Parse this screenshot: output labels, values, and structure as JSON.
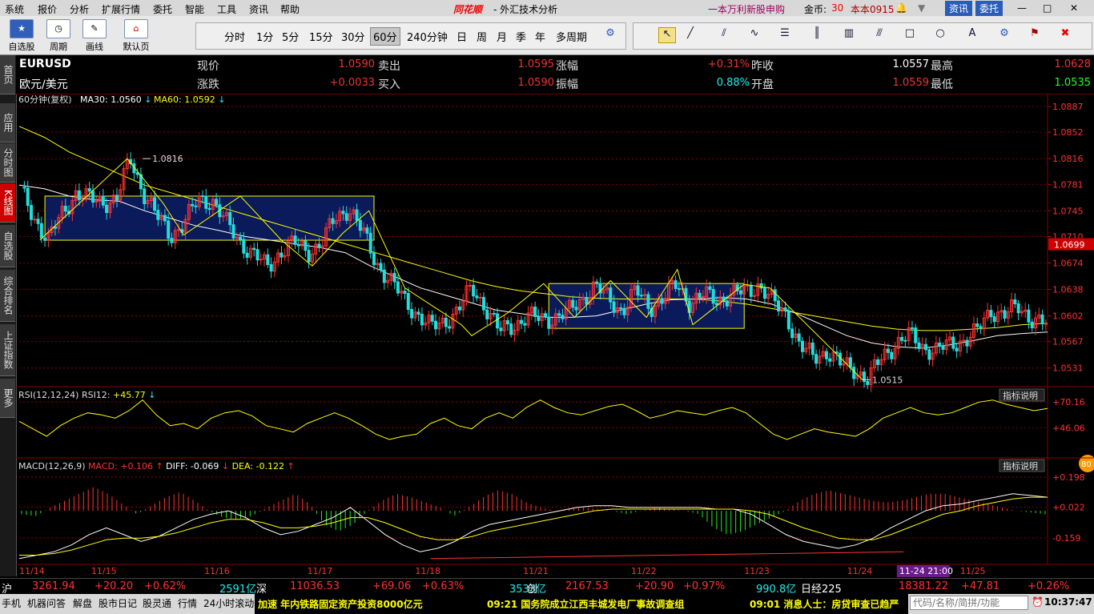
{
  "menu": {
    "items": [
      "系统",
      "报价",
      "分析",
      "扩展行情",
      "委托",
      "智能",
      "工具",
      "资讯",
      "帮助"
    ],
    "brand": "同花顺",
    "app_title": "- 外汇技术分析",
    "promo": "一本万利新股申购",
    "coins_label": "金币:",
    "coins": "30",
    "user": "本本0915",
    "news_btn": "资讯",
    "trade_btn": "委托"
  },
  "toolbar": {
    "buttons": [
      "自选股",
      "周期",
      "画线",
      "默认页"
    ],
    "periods": [
      "分时",
      "1分",
      "5分",
      "15分",
      "30分",
      "60分",
      "240分钟",
      "日",
      "周",
      "月",
      "季",
      "年",
      "多周期"
    ],
    "active_period": "60分"
  },
  "sidebar": {
    "tabs": [
      "首页",
      "应用",
      "分时图",
      "K线图",
      "自选股",
      "综合排名",
      "上证指数",
      "更多"
    ],
    "active": "K线图"
  },
  "quote": {
    "symbol": "EURUSD",
    "name": "欧元/美元",
    "fields": [
      {
        "label": "现价",
        "value": "1.0590"
      },
      {
        "label": "卖出",
        "value": "1.0595"
      },
      {
        "label": "涨幅",
        "value": "+0.31%"
      },
      {
        "label": "昨收",
        "value": "1.0557"
      },
      {
        "label": "最高",
        "value": "1.0628"
      },
      {
        "label": "涨跌",
        "value": "+0.0033"
      },
      {
        "label": "买入",
        "value": "1.0590"
      },
      {
        "label": "振幅",
        "value": "0.88%"
      },
      {
        "label": "开盘",
        "value": "1.0559"
      },
      {
        "label": "最低",
        "value": "1.0535"
      }
    ]
  },
  "colors": {
    "up": "#ff3333",
    "down": "#22dddd",
    "ma30": "#ffffff",
    "ma60": "#ffff00",
    "grid": "#8a0000",
    "box": "#0a1a5a"
  },
  "chart_data": [
    {
      "type": "candlestick",
      "title": "60分钟(复权)",
      "indicators": [
        {
          "name": "MA30",
          "value": "1.0560"
        },
        {
          "name": "MA60",
          "value": "1.0592"
        }
      ],
      "y_ticks": [
        "1.0887",
        "1.0852",
        "1.0816",
        "1.0781",
        "1.0745",
        "1.0710",
        "1.0674",
        "1.0638",
        "1.0602",
        "1.0567",
        "1.0531"
      ],
      "ylim": [
        1.051,
        1.0887
      ],
      "last_price_tag": "1.0699",
      "x_labels": [
        "11/14",
        "11/15",
        "11/16",
        "11/17",
        "11/18",
        "11/21",
        "11/22",
        "11/23",
        "11/24",
        "11/25"
      ],
      "cursor_label": "11-24 21:00",
      "annotations": [
        {
          "text": "1.0816",
          "x": 0.12,
          "y": 1.0816
        },
        {
          "text": "1.0515",
          "x": 0.82,
          "y": 1.0515
        }
      ],
      "close_path": [
        1.077,
        1.0735,
        1.0705,
        1.074,
        1.077,
        1.076,
        1.0758,
        1.076,
        1.0816,
        1.077,
        1.0735,
        1.0712,
        1.073,
        1.076,
        1.076,
        1.0728,
        1.0705,
        1.0685,
        1.0668,
        1.069,
        1.07,
        1.069,
        1.07,
        1.0735,
        1.075,
        1.0715,
        1.0675,
        1.065,
        1.0625,
        1.0605,
        1.0585,
        1.0595,
        1.061,
        1.064,
        1.0615,
        1.058,
        1.059,
        1.06,
        1.0598,
        1.06,
        1.0605,
        1.0625,
        1.0642,
        1.0625,
        1.061,
        1.0635,
        1.0615,
        1.0625,
        1.0645,
        1.062,
        1.063,
        1.0625,
        1.063,
        1.0635,
        1.0645,
        1.062,
        1.0605,
        1.056,
        1.0545,
        1.0555,
        1.0535,
        1.053,
        1.0515,
        1.0545,
        1.0565,
        1.0575,
        1.056,
        1.0555,
        1.0562,
        1.057,
        1.058,
        1.061,
        1.0605,
        1.0612,
        1.06,
        1.059
      ],
      "ma30_path": [
        1.078,
        1.0775,
        1.0765,
        1.076,
        1.0758,
        1.0745,
        1.0735,
        1.0725,
        1.0718,
        1.071,
        1.0705,
        1.07,
        1.0695,
        1.0688,
        1.067,
        1.0655,
        1.064,
        1.063,
        1.062,
        1.061,
        1.0605,
        1.06,
        1.06,
        1.0602,
        1.061,
        1.0618,
        1.0624,
        1.0625,
        1.0627,
        1.0625,
        1.0618,
        1.0605,
        1.059,
        1.0575,
        1.0565,
        1.056,
        1.0558,
        1.0562,
        1.0568,
        1.0575,
        1.0578,
        1.058
      ],
      "ma60_path": [
        1.086,
        1.0845,
        1.0825,
        1.081,
        1.0795,
        1.078,
        1.077,
        1.076,
        1.075,
        1.074,
        1.073,
        1.072,
        1.071,
        1.07,
        1.069,
        1.068,
        1.067,
        1.066,
        1.065,
        1.0642,
        1.0636,
        1.0632,
        1.0628,
        1.0626,
        1.0625,
        1.0625,
        1.0625,
        1.0625,
        1.0622,
        1.0618,
        1.0612,
        1.0606,
        1.06,
        1.0594,
        1.0588,
        1.0584,
        1.0582,
        1.0582,
        1.0584,
        1.0586,
        1.059,
        1.0592
      ]
    },
    {
      "type": "line",
      "title": "RSI(12,12,24)",
      "indicators": [
        {
          "name": "RSI12",
          "value": "+45.77"
        }
      ],
      "y_ticks": [
        "+70.16",
        "+46.06"
      ],
      "ylim": [
        20,
        80
      ],
      "series": [
        {
          "name": "RSI12",
          "values": [
            52,
            45,
            38,
            48,
            55,
            60,
            58,
            55,
            62,
            72,
            58,
            48,
            50,
            45,
            55,
            60,
            62,
            57,
            48,
            45,
            42,
            50,
            55,
            60,
            55,
            48,
            40,
            35,
            38,
            40,
            50,
            55,
            48,
            45,
            55,
            60,
            55,
            65,
            72,
            65,
            60,
            58,
            62,
            66,
            68,
            62,
            55,
            58,
            62,
            60,
            58,
            62,
            65,
            60,
            50,
            40,
            35,
            40,
            45,
            42,
            40,
            38,
            45,
            55,
            60,
            65,
            60,
            58,
            60,
            65,
            70,
            72,
            68,
            65,
            62,
            64
          ]
        }
      ]
    },
    {
      "type": "bar",
      "title": "MACD(12,26,9)",
      "indicators": [
        {
          "name": "MACD",
          "value": "+0.106"
        },
        {
          "name": "DIFF",
          "value": "-0.069"
        },
        {
          "name": "DEA",
          "value": "-0.122"
        }
      ],
      "y_ticks": [
        "+0.198",
        "+0.022",
        "-0.159"
      ],
      "ylim": [
        -0.3,
        0.24
      ],
      "series": [
        {
          "name": "MACD",
          "values": [
            -0.02,
            -0.03,
            0.02,
            0.06,
            0.1,
            0.14,
            0.1,
            0.04,
            -0.02,
            0.03,
            0.08,
            0.11,
            0.06,
            0.0,
            -0.04,
            -0.05,
            -0.03,
            0.02,
            0.06,
            0.1,
            0.04,
            -0.08,
            -0.12,
            -0.08,
            0.0,
            0.06,
            0.1,
            0.08,
            0.05,
            0.02,
            -0.03,
            0.02,
            0.08,
            0.12,
            0.1,
            0.05,
            0.02,
            0.0,
            0.01,
            0.02,
            0.01,
            0.0,
            -0.02,
            0.0,
            0.02,
            0.01,
            0.0,
            -0.02,
            -0.1,
            -0.14,
            -0.12,
            -0.08,
            -0.04,
            0.0,
            0.06,
            0.1,
            0.12,
            0.1,
            0.08,
            0.06,
            0.05,
            0.06,
            0.08,
            0.1,
            0.1,
            0.08,
            0.06,
            0.04,
            0.02,
            0.0,
            -0.01,
            -0.02
          ]
        },
        {
          "name": "DIFF",
          "values": [
            -0.28,
            -0.26,
            -0.24,
            -0.2,
            -0.14,
            -0.1,
            -0.14,
            -0.18,
            -0.15,
            -0.1,
            -0.05,
            -0.02,
            0.0,
            -0.04,
            -0.1,
            -0.14,
            -0.12,
            -0.08,
            -0.04,
            0.02,
            -0.06,
            -0.14,
            -0.2,
            -0.24,
            -0.22,
            -0.18,
            -0.12,
            -0.08,
            -0.06,
            -0.04,
            -0.02,
            0.0,
            0.02,
            0.03,
            0.03,
            0.02,
            0.02,
            0.02,
            0.02,
            0.02,
            0.01,
            0.01,
            -0.02,
            -0.08,
            -0.14,
            -0.18,
            -0.2,
            -0.22,
            -0.2,
            -0.16,
            -0.1,
            -0.05,
            0.0,
            0.03,
            0.04,
            0.06,
            0.08,
            0.1,
            0.09,
            0.08
          ]
        },
        {
          "name": "DEA",
          "values": [
            -0.26,
            -0.26,
            -0.25,
            -0.23,
            -0.2,
            -0.17,
            -0.16,
            -0.16,
            -0.15,
            -0.13,
            -0.1,
            -0.07,
            -0.05,
            -0.05,
            -0.07,
            -0.1,
            -0.1,
            -0.09,
            -0.07,
            -0.04,
            -0.04,
            -0.07,
            -0.11,
            -0.15,
            -0.17,
            -0.17,
            -0.15,
            -0.12,
            -0.1,
            -0.08,
            -0.06,
            -0.04,
            -0.02,
            0.0,
            0.01,
            0.01,
            0.01,
            0.01,
            0.01,
            0.01,
            0.01,
            0.01,
            0.0,
            -0.02,
            -0.06,
            -0.1,
            -0.13,
            -0.16,
            -0.17,
            -0.17,
            -0.14,
            -0.1,
            -0.06,
            -0.02,
            0.0,
            0.03,
            0.05,
            0.07,
            0.08,
            0.08
          ]
        }
      ]
    }
  ],
  "panel": {
    "indicator_help": "指标说明",
    "badge": "80"
  },
  "index_bar": [
    {
      "t": "沪",
      "c": "white"
    },
    {
      "t": "3261.94",
      "c": "red"
    },
    {
      "t": "+20.20",
      "c": "red"
    },
    {
      "t": "+0.62%",
      "c": "red"
    },
    {
      "t": "2591亿",
      "c": "cyan"
    },
    {
      "t": "深",
      "c": "white"
    },
    {
      "t": "11036.53",
      "c": "red"
    },
    {
      "t": "+69.06",
      "c": "red"
    },
    {
      "t": "+0.63%",
      "c": "red"
    },
    {
      "t": "3533亿",
      "c": "cyan"
    },
    {
      "t": "创",
      "c": "white"
    },
    {
      "t": "2167.53",
      "c": "red"
    },
    {
      "t": "+20.90",
      "c": "red"
    },
    {
      "t": "+0.97%",
      "c": "red"
    },
    {
      "t": "990.8亿",
      "c": "cyan"
    },
    {
      "t": "日经225",
      "c": "white"
    },
    {
      "t": "18381.22",
      "c": "red"
    },
    {
      "t": "+47.81",
      "c": "red"
    },
    {
      "t": "+0.26%",
      "c": "red"
    }
  ],
  "news_bar": {
    "tabs": [
      "手机",
      "机器问答",
      "解盘",
      "股市日记",
      "股灵通",
      "行情",
      "24小时滚动"
    ],
    "items": [
      "加速 年内铁路固定资产投资8000亿元",
      "09:21 国务院成立江西丰城发电厂事故调查组",
      "09:01 消息人士：房贷审查已趋严"
    ],
    "search_placeholder": "代码/名称/简拼/功能",
    "clock": "10:37:47"
  }
}
